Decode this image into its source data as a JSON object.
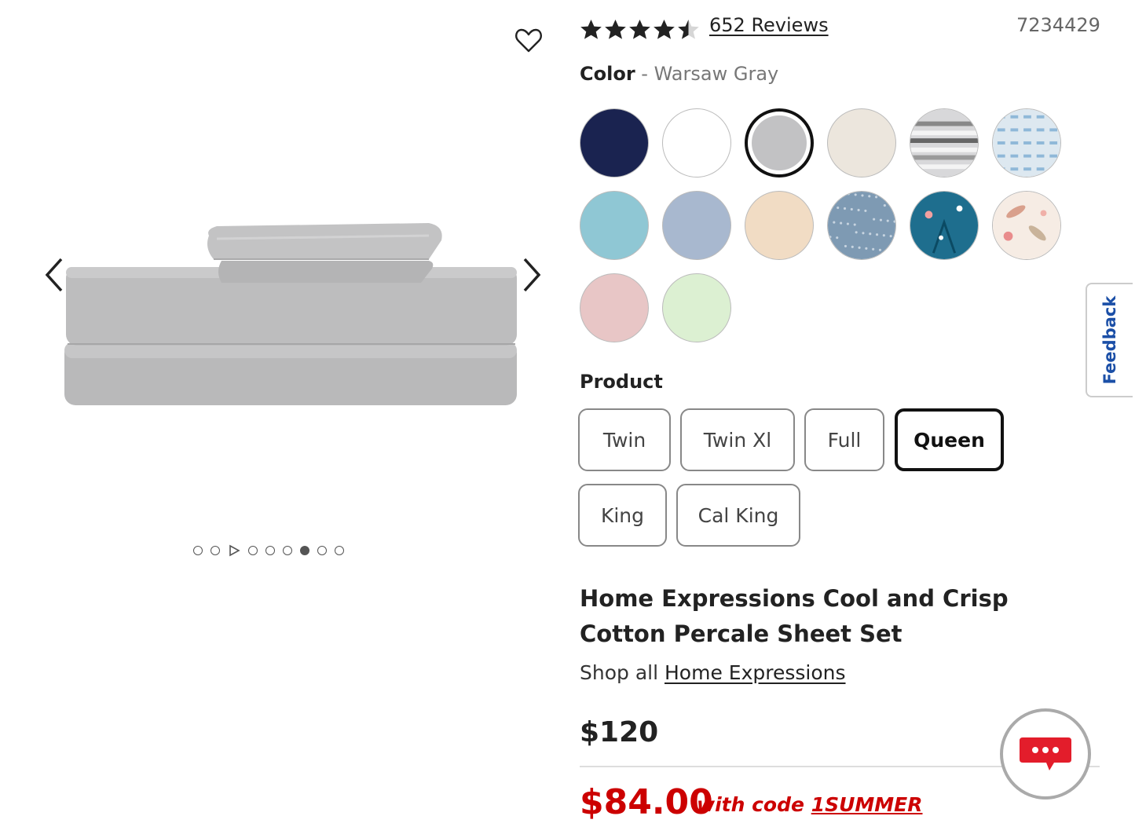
{
  "gallery": {
    "favorite_icon": "heart-outline-icon",
    "prev_icon": "chevron-left-icon",
    "next_icon": "chevron-right-icon",
    "image_subject": "gray folded sheet set",
    "dots": [
      {
        "type": "dot"
      },
      {
        "type": "dot"
      },
      {
        "type": "play"
      },
      {
        "type": "dot"
      },
      {
        "type": "dot"
      },
      {
        "type": "dot"
      },
      {
        "type": "active"
      },
      {
        "type": "dot"
      },
      {
        "type": "dot"
      }
    ]
  },
  "rating": {
    "stars": 4.5,
    "reviews_label": "652 Reviews",
    "sku": "7234429"
  },
  "color": {
    "label": "Color",
    "separator": "-",
    "selected_name": "Warsaw Gray",
    "swatches": [
      {
        "color": "#1a2350"
      },
      {
        "color": "#ffffff"
      },
      {
        "color": "#c2c2c4",
        "selected": true
      },
      {
        "color": "#ece6dd"
      },
      {
        "color": "#d8d8da",
        "pattern": "stripes"
      },
      {
        "color": "#dde8f0",
        "pattern": "pattern-blue"
      },
      {
        "color": "#8fc7d4"
      },
      {
        "color": "#a8b8cf"
      },
      {
        "color": "#f1dcc4"
      },
      {
        "color": "#7e9ab3",
        "pattern": "speckle"
      },
      {
        "color": "#1e6e8e",
        "pattern": "floral-teal"
      },
      {
        "color": "#f6ece4",
        "pattern": "floral-pink"
      },
      {
        "color": "#e8c6c6"
      },
      {
        "color": "#dcf0d2"
      }
    ]
  },
  "product": {
    "label": "Product",
    "sizes": [
      {
        "label": "Twin"
      },
      {
        "label": "Twin Xl"
      },
      {
        "label": "Full"
      },
      {
        "label": "Queen",
        "selected": true
      },
      {
        "label": "King"
      },
      {
        "label": "Cal King"
      }
    ]
  },
  "title": "Home Expressions Cool and Crisp Cotton Percale Sheet Set",
  "shop_all": {
    "prefix": "Shop all",
    "brand": "Home Expressions"
  },
  "pricing": {
    "original": "$120",
    "sale": "$84.00",
    "code_prefix": "with code",
    "code": "1SUMMER",
    "sale_color": "#cc0000"
  },
  "feedback": {
    "label": "Feedback",
    "color": "#1b4fa7"
  },
  "chat": {
    "icon": "chat-bubble-icon",
    "color": "#e31d2b"
  }
}
